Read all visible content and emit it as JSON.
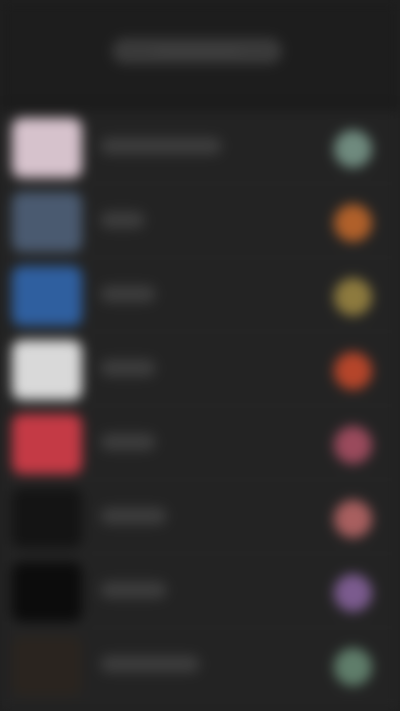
{
  "header": {
    "title": "———————"
  },
  "list": {
    "items": [
      {
        "label": "——————————",
        "thumb_color": "#d6c2cc",
        "dot_color": "#6f8a7e"
      },
      {
        "label": "———",
        "thumb_color": "#4a5a70",
        "dot_color": "#b0602a"
      },
      {
        "label": "————",
        "thumb_color": "#2f5f9f",
        "dot_color": "#8d7a3e"
      },
      {
        "label": "————",
        "thumb_color": "#d9d9d9",
        "dot_color": "#b5452a"
      },
      {
        "label": "————",
        "thumb_color": "#c43a45",
        "dot_color": "#9a4a5c"
      },
      {
        "label": "—————",
        "thumb_color": "#141414",
        "dot_color": "#a85f5f"
      },
      {
        "label": "—————",
        "thumb_color": "#0c0c0c",
        "dot_color": "#7b5b8e"
      },
      {
        "label": "————————",
        "thumb_color": "#2a241f",
        "dot_color": "#5f7d6a"
      }
    ]
  }
}
